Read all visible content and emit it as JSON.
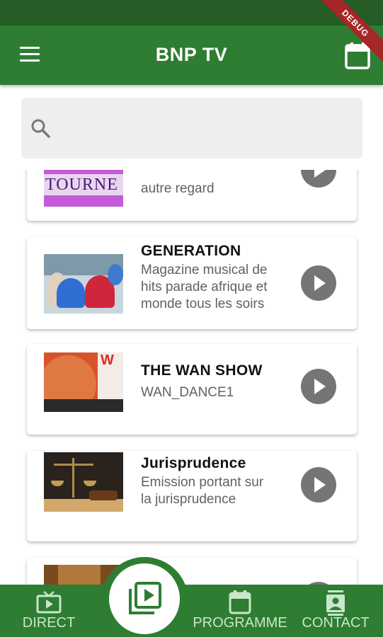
{
  "app": {
    "title": "BNP TV",
    "debug_label": "DEBUG",
    "primary_color": "#2e7d32",
    "status_bar_color": "#245e26"
  },
  "search": {
    "placeholder": "",
    "value": "",
    "icon": "search-icon"
  },
  "programs": [
    {
      "title": "",
      "description": "autre regard",
      "thumb_text": "TOURNE",
      "action_icon": "play-circle-icon"
    },
    {
      "title": "GENERATION",
      "description": "Magazine musical de hits parade afrique et monde tous les soirs",
      "action_icon": "play-circle-icon"
    },
    {
      "title": "THE WAN SHOW",
      "description": "WAN_DANCE1",
      "thumb_text": "W",
      "action_icon": "play-circle-icon"
    },
    {
      "title": "Jurisprudence",
      "description": "Emission portant sur la jurisprudence",
      "action_icon": "play-circle-icon"
    },
    {
      "title": "",
      "description": "",
      "action_icon": "play-circle-icon"
    }
  ],
  "bottom_nav": {
    "direct": {
      "label": "DIRECT",
      "icon": "tv-icon"
    },
    "center": {
      "icon": "video-library-icon"
    },
    "programme": {
      "label": "PROGRAMME",
      "icon": "calendar-icon"
    },
    "contact": {
      "label": "CONTACT",
      "icon": "contact-card-icon"
    }
  }
}
